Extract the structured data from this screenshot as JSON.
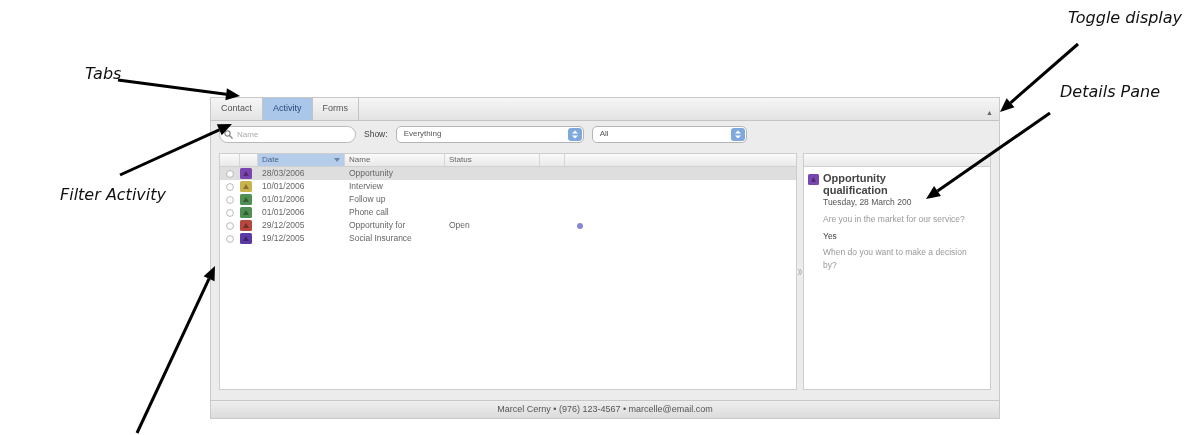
{
  "annotations": [
    {
      "text": "Tabs",
      "kind": "label"
    },
    {
      "text": "Toggle display",
      "kind": "label"
    },
    {
      "text": "Details Pane",
      "kind": "label"
    },
    {
      "text": "Filter Activity",
      "kind": "label"
    },
    {
      "kind": "arrow-only"
    }
  ],
  "tabs": [
    {
      "label": "Contact",
      "selected": false
    },
    {
      "label": "Activity",
      "selected": true
    },
    {
      "label": "Forms",
      "selected": false
    }
  ],
  "toggle": {
    "text": "▲"
  },
  "filter": {
    "placeholder": "Name",
    "show_label": "Show:",
    "show_value": "Everything",
    "scope_value": "All"
  },
  "table": {
    "columns": [
      {
        "label": "Date",
        "sorted": true
      },
      {
        "label": "Name",
        "sorted": false
      },
      {
        "label": "Status",
        "sorted": false
      }
    ],
    "rows": [
      {
        "checked": false,
        "color": "#7b45b0",
        "date": "28/03/2006",
        "name": "Opportunity",
        "status": "",
        "flagged": false,
        "selected": true
      },
      {
        "checked": false,
        "color": "#c9b24c",
        "date": "10/01/2006",
        "name": "Interview",
        "status": "",
        "flagged": false,
        "selected": false
      },
      {
        "checked": false,
        "color": "#4f8f52",
        "date": "01/01/2006",
        "name": "Follow up",
        "status": "",
        "flagged": false,
        "selected": false
      },
      {
        "checked": false,
        "color": "#4f8f52",
        "date": "01/01/2006",
        "name": "Phone call",
        "status": "",
        "flagged": false,
        "selected": false
      },
      {
        "checked": false,
        "color": "#b5473f",
        "date": "29/12/2005",
        "name": "Opportunity for",
        "status": "Open",
        "flagged": true,
        "selected": false
      },
      {
        "checked": false,
        "color": "#5b3aa6",
        "date": "19/12/2005",
        "name": "Social Insurance",
        "status": "",
        "flagged": false,
        "selected": false
      }
    ]
  },
  "details": {
    "color": "#7b45b0",
    "title": "Opportunity qualification",
    "date": "Tuesday, 28 March 200",
    "items": [
      {
        "kind": "question",
        "text": "Are you in the market for our service?"
      },
      {
        "kind": "answer",
        "text": "Yes"
      },
      {
        "kind": "question",
        "text": "When do you want to make a decision by?"
      }
    ]
  },
  "status_bar": {
    "text": "Marcel Cerny • (976) 123-4567 • marcelle@email.com"
  }
}
